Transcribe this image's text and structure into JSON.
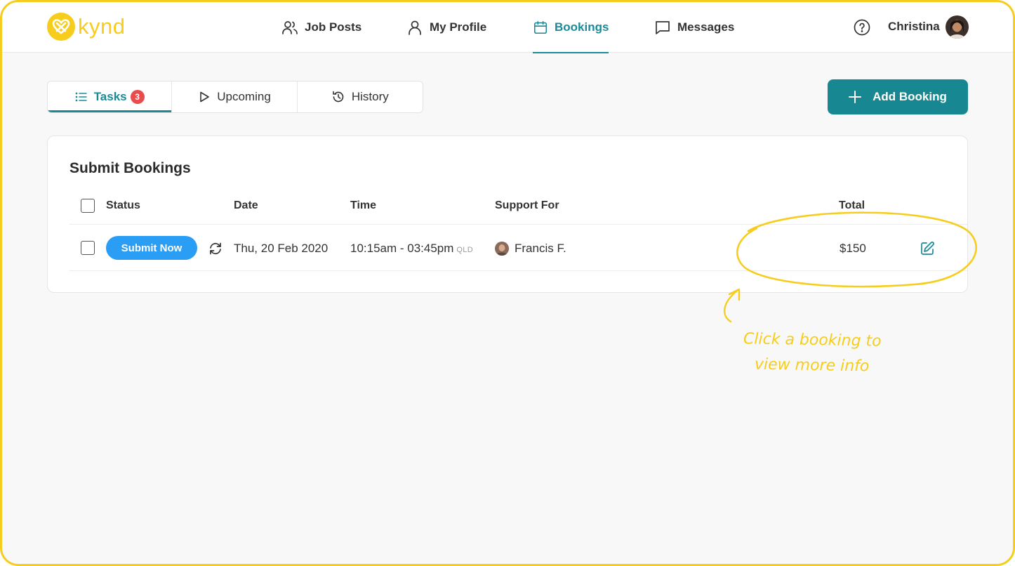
{
  "brand": {
    "name": "kynd",
    "color": "#f6cd1c"
  },
  "nav": {
    "items": [
      {
        "label": "Job Posts",
        "icon": "users-icon"
      },
      {
        "label": "My Profile",
        "icon": "user-icon"
      },
      {
        "label": "Bookings",
        "icon": "calendar-icon",
        "active": true
      },
      {
        "label": "Messages",
        "icon": "chat-icon"
      }
    ],
    "help_icon": "help-icon",
    "user_name": "Christina"
  },
  "tabs": [
    {
      "label": "Tasks",
      "badge": "3",
      "icon": "list-icon",
      "active": true
    },
    {
      "label": "Upcoming",
      "icon": "play-icon"
    },
    {
      "label": "History",
      "icon": "history-icon"
    }
  ],
  "add_booking_label": "Add Booking",
  "card": {
    "title": "Submit Bookings",
    "columns": [
      "Status",
      "Date",
      "Time",
      "Support For",
      "Total"
    ],
    "rows": [
      {
        "status_button": "Submit Now",
        "date": "Thu, 20 Feb 2020",
        "time": "10:15am - 03:45pm",
        "timezone": "QLD",
        "support_for": "Francis F.",
        "total": "$150"
      }
    ]
  },
  "annotation": {
    "line1": "Click a booking to",
    "line2": "view more info"
  },
  "colors": {
    "accent": "#1a8a97",
    "button_blue": "#2a9df4",
    "badge_red": "#e84c4c",
    "highlight": "#f6cd1c"
  }
}
